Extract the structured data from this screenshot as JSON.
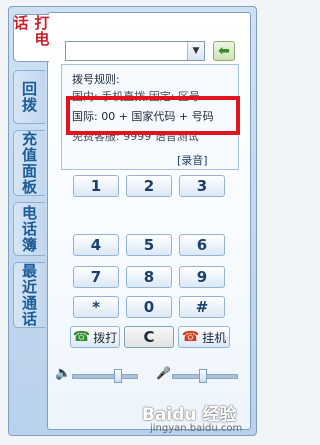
{
  "tabs": [
    {
      "label": "打电话",
      "active": true
    },
    {
      "label": "回拨",
      "active": false
    },
    {
      "label": "充值面板",
      "active": false
    },
    {
      "label": "电话簿",
      "active": false
    },
    {
      "label": "最近通话",
      "active": false
    }
  ],
  "number_input": {
    "value": ""
  },
  "rules": {
    "title": "拨号规则:",
    "line_domestic": "国内: 手机直拨,固定: 区号",
    "line_international": "国际: 00 + 国家代码 + 号码",
    "line_service": "免费客服: 9999 语音测试"
  },
  "record_label": "[录音]",
  "keypad": [
    "1",
    "2",
    "3",
    "4",
    "5",
    "6",
    "7",
    "8",
    "9",
    "*",
    "0",
    "#"
  ],
  "actions": {
    "dial": "拨打",
    "clear": "C",
    "hangup": "挂机"
  },
  "volume": {
    "speaker_level": 0.7,
    "mic_level": 0.45
  },
  "watermark": {
    "brand": "Baidu 经验",
    "url": "jingyan.baidu.com"
  },
  "colors": {
    "highlight": "#e0141c",
    "accent": "#1a5d99",
    "active_tab_text": "#c5222a"
  }
}
